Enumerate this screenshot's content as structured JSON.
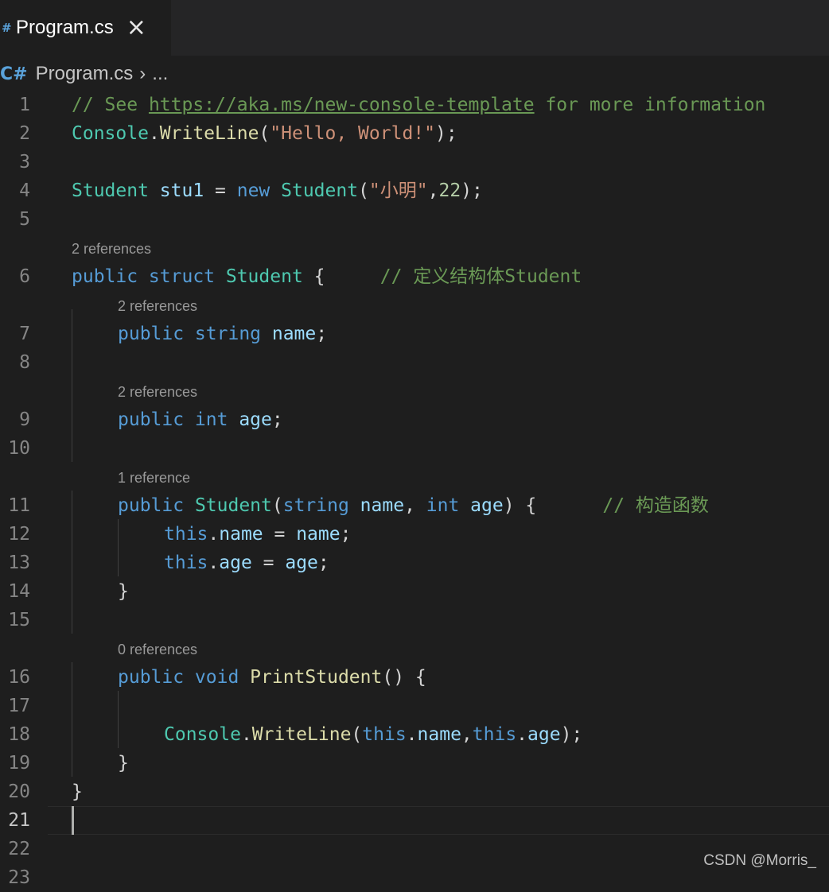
{
  "tab": {
    "icon": "#",
    "label": "Program.cs",
    "close": "×"
  },
  "breadcrumb": {
    "icon": "C#",
    "file": "Program.cs",
    "separator": "›",
    "more": "..."
  },
  "lens": {
    "l6": "2 references",
    "l7": "2 references",
    "l9": "2 references",
    "l11": "1 reference",
    "l16": "0 references"
  },
  "line_numbers": [
    "1",
    "2",
    "3",
    "4",
    "5",
    "6",
    "7",
    "8",
    "9",
    "10",
    "11",
    "12",
    "13",
    "14",
    "15",
    "16",
    "17",
    "18",
    "19",
    "20",
    "21",
    "22",
    "23"
  ],
  "code": {
    "l1": {
      "comment": "// See ",
      "link": "https://aka.ms/new-console-template",
      "rest": " for more information"
    },
    "l2": {
      "cls": "Console",
      "dot": ".",
      "method": "WriteLine",
      "open": "(",
      "str": "\"Hello, World!\"",
      "close": ");"
    },
    "l4": {
      "type": "Student",
      "var": " stu1",
      "eq": " = ",
      "kw": "new",
      "type2": " Student",
      "open": "(",
      "str": "\"小明\"",
      "comma": ",",
      "num": "22",
      "close": ");"
    },
    "l6": {
      "kw": "public struct",
      "type": " Student",
      "brace": " {",
      "comment": "     // 定义结构体Student"
    },
    "l7": {
      "kw": "public string",
      "var": " name",
      "semi": ";"
    },
    "l9": {
      "kw": "public int",
      "var": " age",
      "semi": ";"
    },
    "l11": {
      "kw": "public",
      "type": " Student",
      "open": "(",
      "kw2": "string",
      "var1": " name",
      "comma": ", ",
      "kw3": "int",
      "var2": " age",
      "close": ") {",
      "comment": "      // 构造函数"
    },
    "l12": {
      "kw": "this",
      "dot": ".",
      "var": "name",
      "eq": " = ",
      "var2": "name",
      "semi": ";"
    },
    "l13": {
      "kw": "this",
      "dot": ".",
      "var": "age",
      "eq": " = ",
      "var2": "age",
      "semi": ";"
    },
    "l14": {
      "brace": "}"
    },
    "l16": {
      "kw": "public void",
      "fn": " PrintStudent",
      "rest": "() {"
    },
    "l18": {
      "cls": "Console",
      "dot": ".",
      "method": "WriteLine",
      "open": "(",
      "kw1": "this",
      "dot1": ".",
      "var1": "name",
      "comma": ",",
      "kw2": "this",
      "dot2": ".",
      "var2": "age",
      "close": ");"
    },
    "l19": {
      "brace": "}"
    },
    "l20": {
      "brace": "}"
    }
  },
  "watermark": "CSDN @Morris_",
  "colors": {
    "background": "#1e1e1e",
    "keyword": "#569cd6",
    "type": "#4ec9b0",
    "function": "#dcdcaa",
    "string": "#ce9178",
    "comment": "#6a9955",
    "variable": "#9cdcfe"
  }
}
